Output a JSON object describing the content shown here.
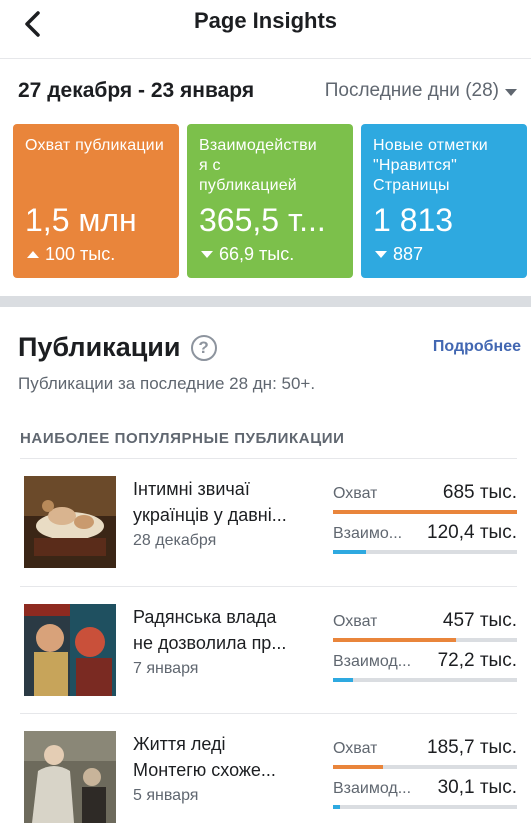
{
  "header": {
    "title": "Page Insights",
    "back_icon": "chevron-left-icon"
  },
  "date_row": {
    "range": "27 декабря - 23 января",
    "period_select": "Последние дни (28)"
  },
  "metrics": [
    {
      "label": "Охват публикации",
      "value": "1,5 млн",
      "delta": "100 тыс.",
      "direction": "up",
      "color": "#e9853b"
    },
    {
      "label": "Взаимодействия с публикацией",
      "value": "365,5 т...",
      "delta": "66,9 тыс.",
      "direction": "down",
      "color": "#7cc04b"
    },
    {
      "label": "Новые отметки \"Нравится\" Страницы",
      "value": "1 813",
      "delta": "887",
      "direction": "down",
      "color": "#2ea9e0"
    }
  ],
  "publications": {
    "title": "Публикации",
    "more_link": "Подробнее",
    "subtitle": "Публикации за последние 28 дн: 50+.",
    "popular_heading": "НАИБОЛЕЕ ПОПУЛЯРНЫЕ ПУБЛИКАЦИИ",
    "posts": [
      {
        "title_line1": "Інтимні звичаї",
        "title_line2": "українців у давні...",
        "date": "28 декабря",
        "reach_label": "Охват",
        "reach_value": "685 тыс.",
        "reach_fraction": 1.0,
        "engagement_label": "Взаимо...",
        "engagement_value": "120,4 тыс.",
        "engagement_fraction": 0.18
      },
      {
        "title_line1": "Радянська влада",
        "title_line2": "не дозволила пр...",
        "date": "7 января",
        "reach_label": "Охват",
        "reach_value": "457 тыс.",
        "reach_fraction": 0.67,
        "engagement_label": "Взаимод...",
        "engagement_value": "72,2 тыс.",
        "engagement_fraction": 0.11
      },
      {
        "title_line1": "Життя леді",
        "title_line2": "Монтегю схоже...",
        "date": "5 января",
        "reach_label": "Охват",
        "reach_value": "185,7 тыс.",
        "reach_fraction": 0.27,
        "engagement_label": "Взаимод...",
        "engagement_value": "30,1 тыс.",
        "engagement_fraction": 0.04
      }
    ]
  }
}
